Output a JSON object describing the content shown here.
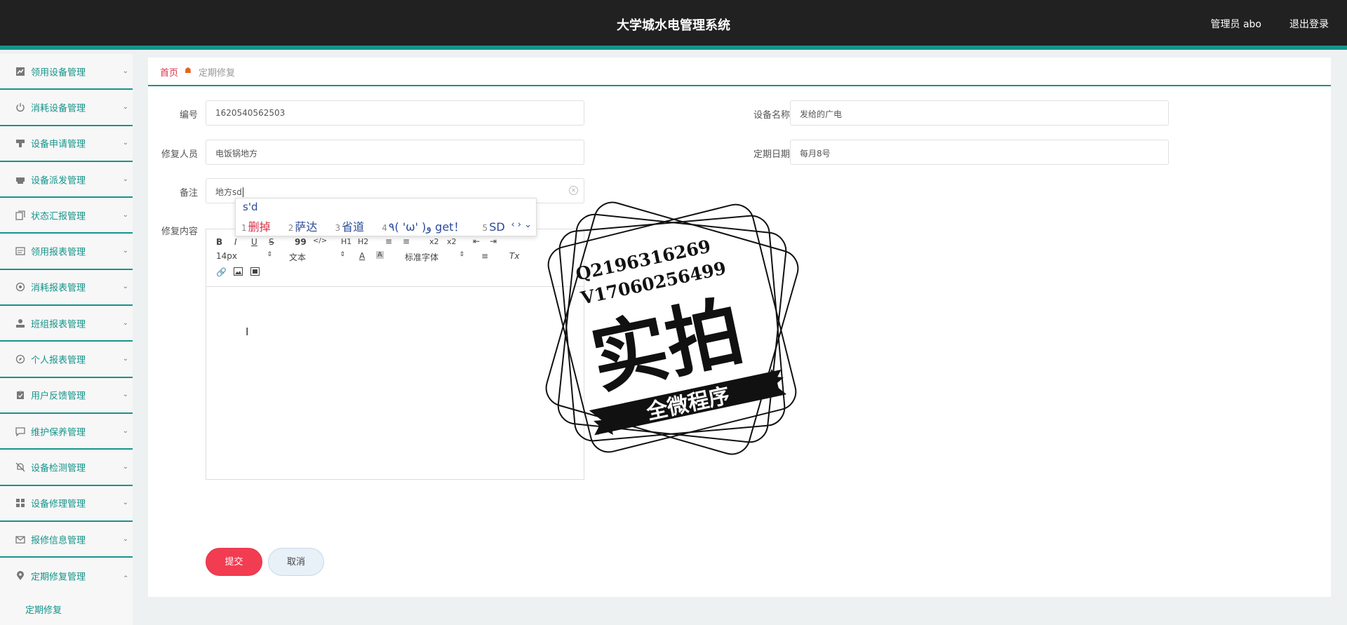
{
  "header": {
    "title": "大学城水电管理系统",
    "user": "管理员 abo",
    "logout": "退出登录"
  },
  "sidebar": {
    "items": [
      {
        "label": "领用设备管理",
        "icon": "chart-icon"
      },
      {
        "label": "消耗设备管理",
        "icon": "power-icon"
      },
      {
        "label": "设备申请管理",
        "icon": "stamp-icon"
      },
      {
        "label": "设备派发管理",
        "icon": "printer-icon"
      },
      {
        "label": "状态汇报管理",
        "icon": "copy-icon"
      },
      {
        "label": "领用报表管理",
        "icon": "list-icon"
      },
      {
        "label": "消耗报表管理",
        "icon": "aperture-icon"
      },
      {
        "label": "班组报表管理",
        "icon": "person-icon"
      },
      {
        "label": "个人报表管理",
        "icon": "compass-icon"
      },
      {
        "label": "用户反馈管理",
        "icon": "clipboard-icon"
      },
      {
        "label": "维护保养管理",
        "icon": "message-icon"
      },
      {
        "label": "设备检测管理",
        "icon": "bell-off-icon"
      },
      {
        "label": "设备修理管理",
        "icon": "grid-icon"
      },
      {
        "label": "报修信息管理",
        "icon": "mail-icon"
      },
      {
        "label": "定期修复管理",
        "icon": "location-icon",
        "expanded": true
      }
    ],
    "subitem": "定期修复"
  },
  "breadcrumb": {
    "home": "首页",
    "current": "定期修复"
  },
  "form": {
    "id_label": "编号",
    "id_value": "1620540562503",
    "device_label": "设备名称",
    "device_value": "发给的广电",
    "repairer_label": "修复人员",
    "repairer_value": "电饭锅地方",
    "date_label": "定期日期",
    "date_value": "每月8号",
    "note_label": "备注",
    "note_value": "地方sd",
    "content_label": "修复内容"
  },
  "editor": {
    "bold": "B",
    "italic": "I",
    "underline": "U",
    "strike": "S",
    "quote": "99",
    "code": "</>",
    "h1": "H1",
    "h2": "H2",
    "sub": "x2",
    "sup": "x2",
    "font_size": "14px",
    "text_type": "文本",
    "font_family": "标准字体",
    "clear_format": "Tx"
  },
  "ime": {
    "input": "s'd",
    "candidates": [
      {
        "n": "1",
        "text": "删掉"
      },
      {
        "n": "2",
        "text": "萨达"
      },
      {
        "n": "3",
        "text": "省道"
      },
      {
        "n": "4",
        "text": "٩( 'ω' )و get！"
      },
      {
        "n": "5",
        "text": "SD"
      }
    ]
  },
  "buttons": {
    "submit": "提交",
    "cancel": "取消"
  },
  "watermark": {
    "line1": "Q2196316269",
    "line2": "V17060256499",
    "main": "实拍",
    "banner": "全微程序"
  },
  "colors": {
    "accent": "#16948a",
    "danger": "#f23c52",
    "topbar": "#212121"
  }
}
